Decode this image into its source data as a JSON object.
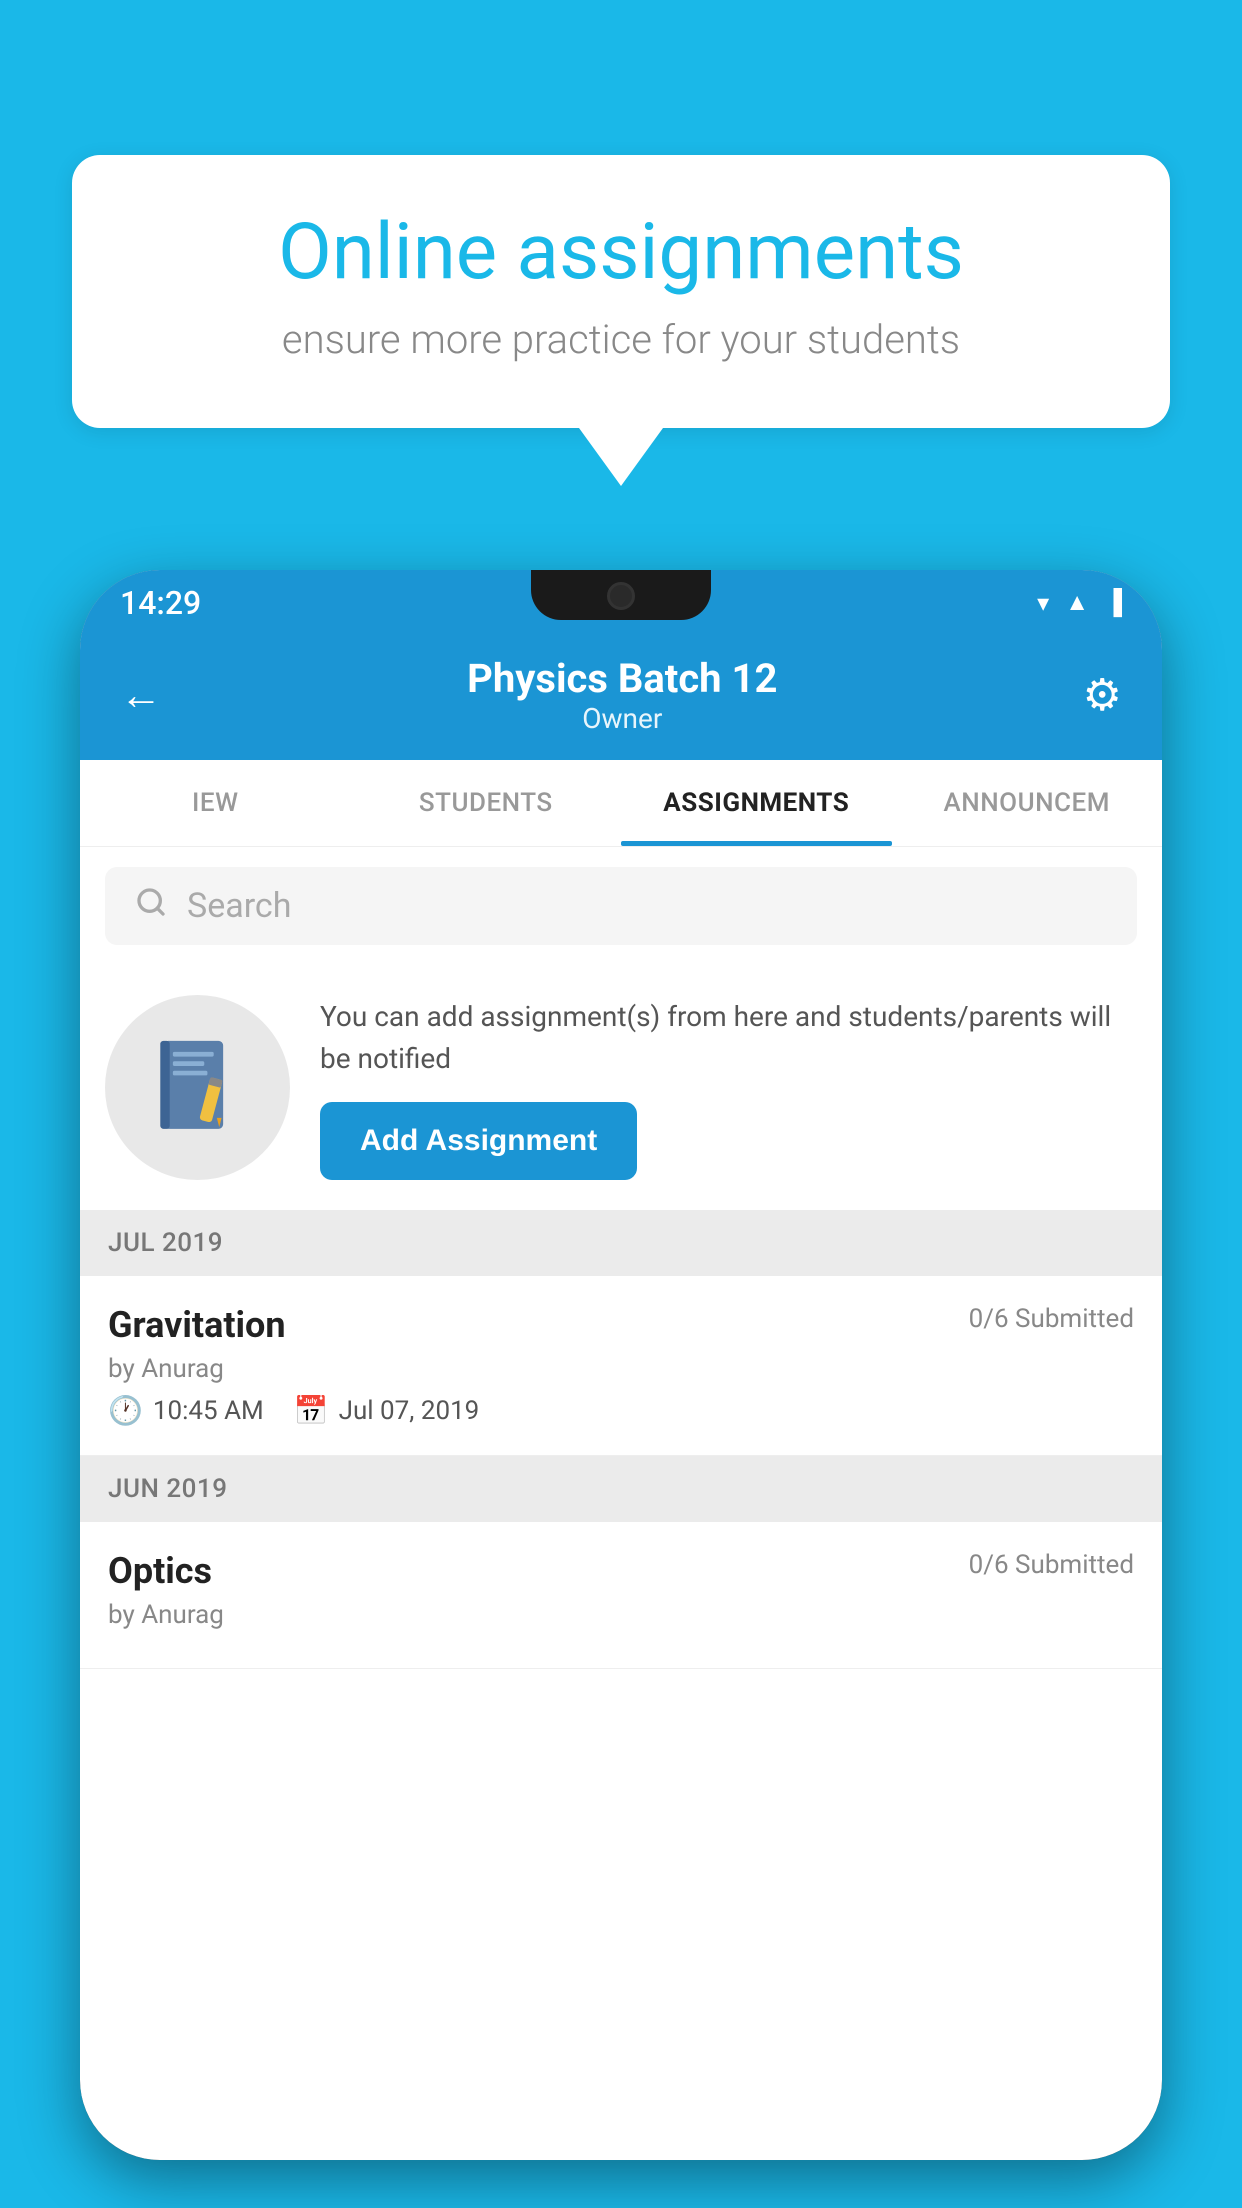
{
  "background_color": "#1ab8e8",
  "speech_bubble": {
    "title": "Online assignments",
    "subtitle": "ensure more practice for your students"
  },
  "phone": {
    "status_bar": {
      "time": "14:29",
      "icons": [
        "wifi",
        "signal",
        "battery"
      ]
    },
    "header": {
      "title": "Physics Batch 12",
      "subtitle": "Owner",
      "back_label": "←",
      "settings_label": "⚙"
    },
    "tabs": [
      {
        "label": "IEW",
        "active": false
      },
      {
        "label": "STUDENTS",
        "active": false
      },
      {
        "label": "ASSIGNMENTS",
        "active": true
      },
      {
        "label": "ANNOUNCEM",
        "active": false
      }
    ],
    "search": {
      "placeholder": "Search"
    },
    "info_section": {
      "description": "You can add assignment(s) from here and students/parents will be notified",
      "button_label": "Add Assignment"
    },
    "sections": [
      {
        "month_label": "JUL 2019",
        "assignments": [
          {
            "name": "Gravitation",
            "submitted": "0/6 Submitted",
            "by": "by Anurag",
            "time": "10:45 AM",
            "date": "Jul 07, 2019"
          }
        ]
      },
      {
        "month_label": "JUN 2019",
        "assignments": [
          {
            "name": "Optics",
            "submitted": "0/6 Submitted",
            "by": "by Anurag",
            "time": "",
            "date": ""
          }
        ]
      }
    ]
  }
}
